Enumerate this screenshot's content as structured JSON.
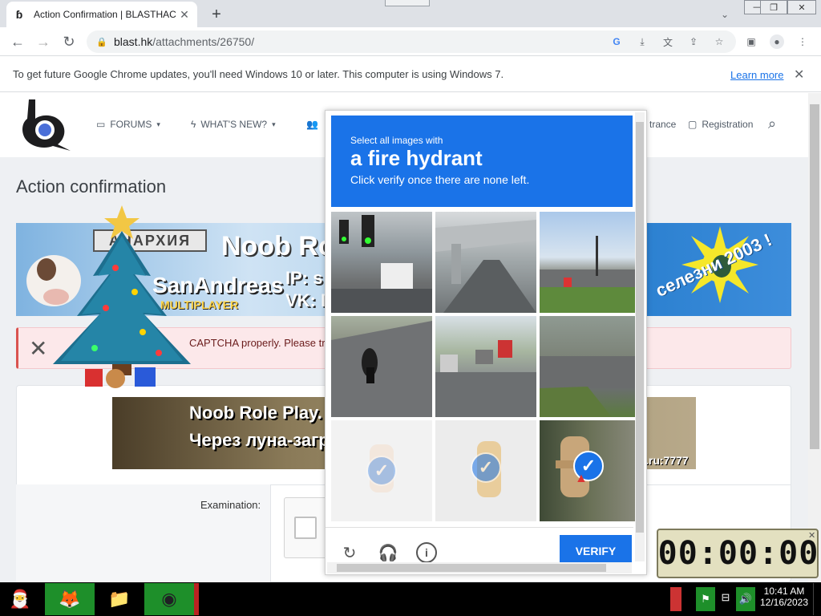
{
  "browser": {
    "tab_title": "Action Confirmation | BLASTHAC",
    "new_tab_label": "+",
    "url_host": "blast.hk",
    "url_path": "/attachments/26750/",
    "win_min": "—",
    "win_restore": "❐",
    "win_close": "✕"
  },
  "infobar": {
    "message": "To get future Google Chrome updates, you'll need Windows 10 or later. This computer is using Windows 7.",
    "learn_more": "Learn more"
  },
  "site": {
    "nav": [
      {
        "label": "FORUMS",
        "icon": "forums-icon"
      },
      {
        "label": "WHAT'S NEW?",
        "icon": "whats-new-icon"
      }
    ],
    "nav_right": [
      {
        "label": "trance"
      },
      {
        "label": "Registration"
      }
    ],
    "page_title": "Action confirmation",
    "banner": {
      "logo_text": "АНАРХИЯ",
      "title": "Noob Role",
      "ip_line": "IP: s",
      "vk_line": "VK: I",
      "san_andreas": "SanAndreas",
      "multiplayer": "MULTIPLAYER",
      "right_text": "селезни 2003 !"
    },
    "alert_text": "CAPTCHA properly. Please try",
    "banner2": {
      "line1": "Noob Role Play. У на",
      "line2": "Через луна-загружат",
      "line3": ".ru:7777"
    },
    "form_label": "Examination:"
  },
  "captcha": {
    "instruction_top": "Select all images with",
    "object": "a fire hydrant",
    "instruction_bottom": "Click verify once there are none left.",
    "verify_label": "VERIFY",
    "tiles": [
      {
        "desc": "traffic light street",
        "selected": false
      },
      {
        "desc": "overpass road",
        "selected": false
      },
      {
        "desc": "intersection",
        "selected": false
      },
      {
        "desc": "motorcycle",
        "selected": false
      },
      {
        "desc": "traffic cars",
        "selected": false
      },
      {
        "desc": "street corner",
        "selected": false
      },
      {
        "desc": "hydrant faded",
        "selected": true
      },
      {
        "desc": "hydrant faded 2",
        "selected": true
      },
      {
        "desc": "hydrant",
        "selected": true
      }
    ]
  },
  "timer": {
    "display": "00:00:00"
  },
  "taskbar": {
    "time": "10:41 AM",
    "date": "12/16/2023"
  },
  "colors": {
    "accent": "#1a73e8",
    "alert_bg": "#fce8ea",
    "taskbar": "#000000"
  }
}
